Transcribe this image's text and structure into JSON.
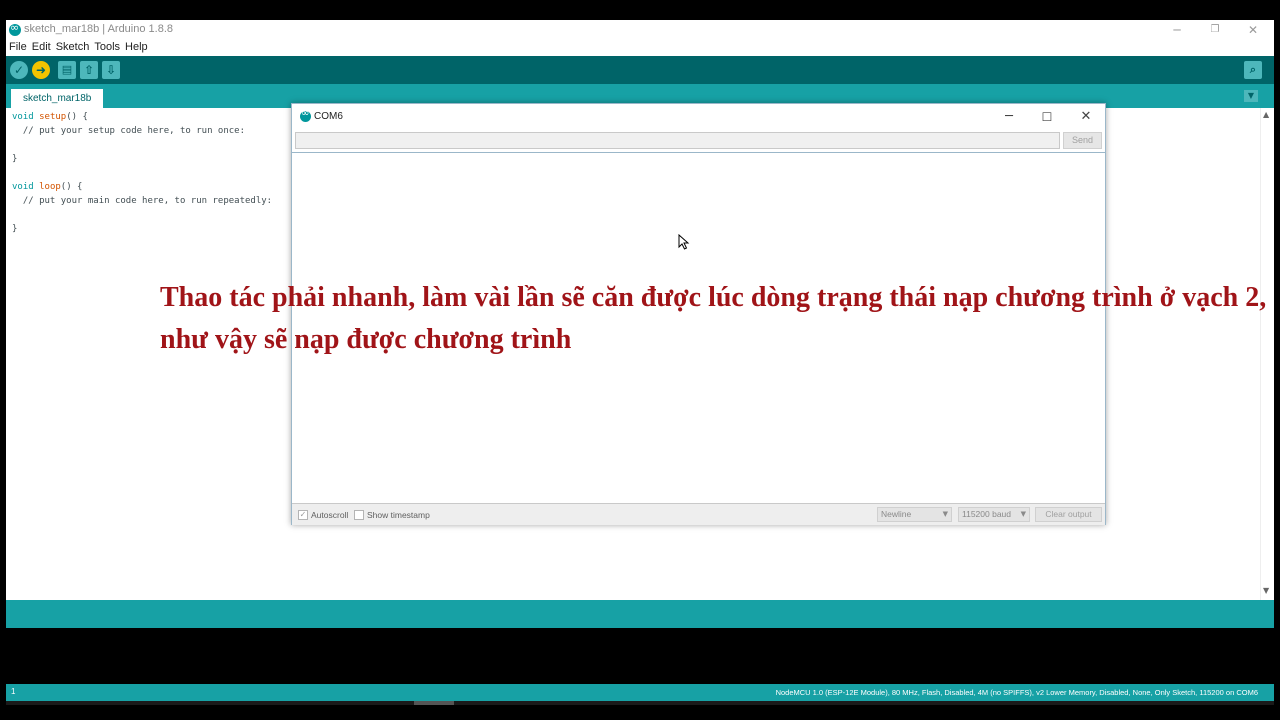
{
  "window": {
    "title": "sketch_mar18b | Arduino 1.8.8",
    "minimize_icon": "minimize-icon",
    "maximize_icon": "restore-icon",
    "close_icon": "close-icon"
  },
  "menu": [
    "File",
    "Edit",
    "Sketch",
    "Tools",
    "Help"
  ],
  "toolbar": {
    "buttons": [
      "verify-icon",
      "upload-icon",
      "new-icon",
      "open-icon",
      "save-icon"
    ],
    "serial_monitor_icon": "serial-monitor-icon"
  },
  "tab": {
    "label": "sketch_mar18b"
  },
  "code": [
    "void setup() {",
    "  // put your setup code here, to run once:",
    "",
    "}",
    "",
    "void loop() {",
    "  // put your main code here, to run repeatedly:",
    "",
    "}"
  ],
  "serial_monitor": {
    "title": "COM6",
    "send_label": "Send",
    "input_value": "",
    "autoscroll_label": "Autoscroll",
    "autoscroll_checked": true,
    "timestamp_label": "Show timestamp",
    "timestamp_checked": false,
    "line_ending": "Newline",
    "baud": "115200 baud",
    "clear_label": "Clear output"
  },
  "status_bar": {
    "line_number": "1",
    "board_info": "NodeMCU 1.0 (ESP-12E Module), 80 MHz, Flash, Disabled, 4M (no SPIFFS), v2 Lower Memory, Disabled, None, Only Sketch, 115200 on COM6"
  },
  "caption": {
    "line1": "Thao tác phải nhanh, làm vài lần sẽ căn được lúc dòng trạng thái nạp chương trình ở vạch 2,",
    "line2": "như vậy sẽ nạp được chương trình"
  },
  "colors": {
    "teal_dark": "#006468",
    "teal": "#17a1a5",
    "caption": "#a01418"
  }
}
